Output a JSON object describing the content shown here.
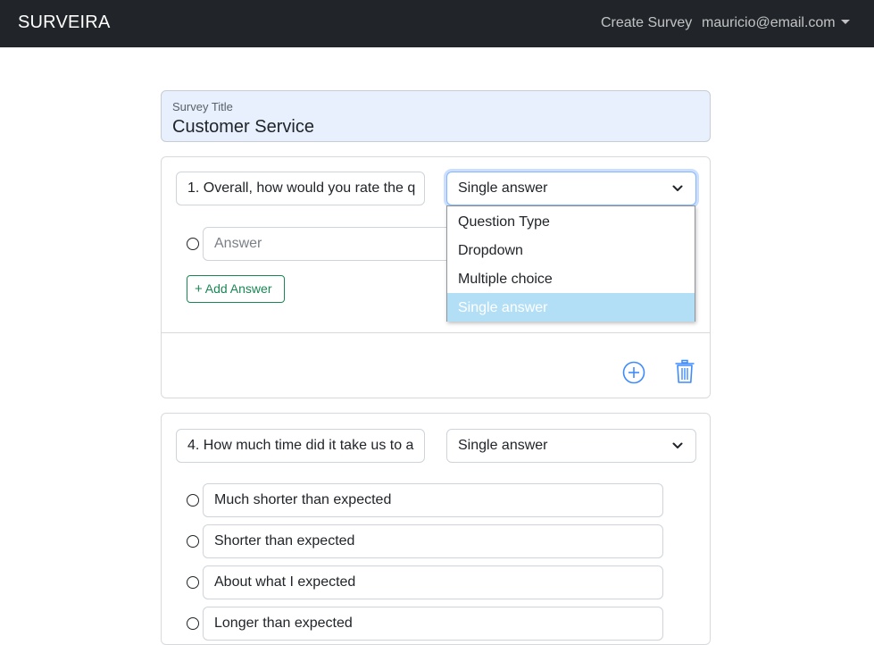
{
  "navbar": {
    "brand": "SURVEIRA",
    "create_survey": "Create Survey",
    "user_email": "mauricio@email.com"
  },
  "survey": {
    "title_label": "Survey Title",
    "title_value": "Customer Service"
  },
  "questions": [
    {
      "text": "1. Overall, how would you rate the q",
      "type": "Single answer",
      "answer_placeholder": "Answer",
      "add_answer_label": "Add Answer",
      "type_options": [
        "Question Type",
        "Dropdown",
        "Multiple choice",
        "Single answer"
      ],
      "selected_option": "Single answer"
    },
    {
      "text": "4. How much time did it take us to a",
      "type": "Single answer",
      "answers": [
        "Much shorter than expected",
        "Shorter than expected",
        "About what I expected",
        "Longer than expected"
      ]
    }
  ],
  "icons": {
    "add_question": "plus-circle-icon",
    "delete_question": "trash-icon",
    "select_arrow": "chevron-down-icon",
    "add_answer": "plus-icon"
  },
  "colors": {
    "navbar_bg": "#212529",
    "title_bg": "#e8f0fe",
    "accent_blue": "#0d6efd",
    "success_green": "#198754",
    "dropdown_selected": "#b3dff6"
  }
}
